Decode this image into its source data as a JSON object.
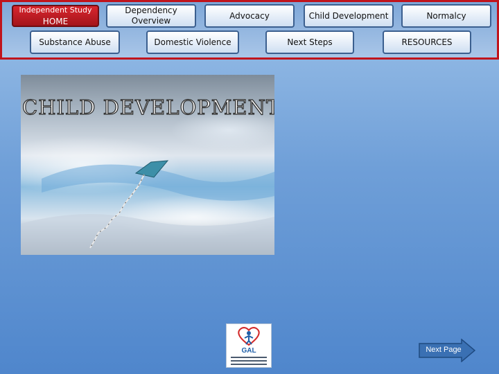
{
  "nav": {
    "home": {
      "line1": "Independent Study",
      "line2": "HOME"
    },
    "dependency_overview": "Dependency Overview",
    "advocacy": "Advocacy",
    "child_development": "Child Development",
    "normalcy": "Normalcy",
    "substance_abuse": "Substance Abuse",
    "domestic_violence": "Domestic Violence",
    "next_steps": "Next Steps",
    "resources": "RESOURCES"
  },
  "hero": {
    "title": "CHILD DEVELOPMENT"
  },
  "logo": {
    "text": "GAL"
  },
  "footer": {
    "next_page": "Next Page"
  },
  "colors": {
    "frame_red": "#c0141c",
    "home_red": "#b81b22",
    "button_border": "#3b5f8f",
    "arrow_blue": "#3a70b3"
  }
}
